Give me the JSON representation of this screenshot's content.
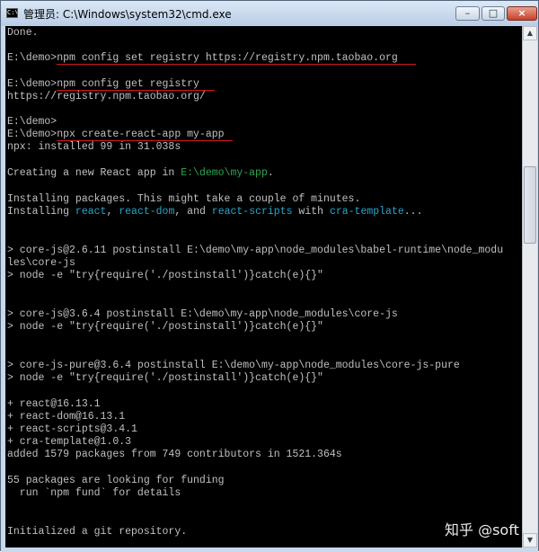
{
  "window": {
    "icon_label": "C:\\",
    "title": "管理员: C:\\Windows\\system32\\cmd.exe",
    "controls": {
      "minimize": "–",
      "maximize": "□",
      "close": "×"
    }
  },
  "scrollbar": {
    "up": "▲",
    "down": "▼"
  },
  "console": {
    "lines": {
      "l0": "Done.",
      "l2": "E:\\demo>npm config set registry https://registry.npm.taobao.org",
      "l4": "E:\\demo>npm config get registry",
      "l5": "https://registry.npm.taobao.org/",
      "l7": "E:\\demo>",
      "l8": "E:\\demo>npx create-react-app my-app",
      "l9": "npx: installed 99 in 31.038s",
      "l11_a": "Creating a new React app in ",
      "l11_path": "E:\\demo\\my-app",
      "l11_b": ".",
      "l13": "Installing packages. This might take a couple of minutes.",
      "l14_a": "Installing ",
      "l14_pkg1": "react",
      "l14_b": ", ",
      "l14_pkg2": "react-dom",
      "l14_c": ", and ",
      "l14_pkg3": "react-scripts",
      "l14_d": " with ",
      "l14_pkg4": "cra-template",
      "l14_e": "...",
      "l17": "> core-js@2.6.11 postinstall E:\\demo\\my-app\\node_modules\\babel-runtime\\node_modu",
      "l18": "les\\core-js",
      "l19": "> node -e \"try{require('./postinstall')}catch(e){}\"",
      "l21": "> core-js@3.6.4 postinstall E:\\demo\\my-app\\node_modules\\core-js",
      "l22": "> node -e \"try{require('./postinstall')}catch(e){}\"",
      "l25": "> core-js-pure@3.6.4 postinstall E:\\demo\\my-app\\node_modules\\core-js-pure",
      "l26": "> node -e \"try{require('./postinstall')}catch(e){}\"",
      "l28": "+ react@16.13.1",
      "l29": "+ react-dom@16.13.1",
      "l30": "+ react-scripts@3.4.1",
      "l31": "+ cra-template@1.0.3",
      "l32": "added 1579 packages from 749 contributors in 1521.364s",
      "l34": "55 packages are looking for funding",
      "l35": "  run `npm fund` for details",
      "l38": "Initialized a git repository."
    }
  },
  "watermark": "知乎 @soft"
}
